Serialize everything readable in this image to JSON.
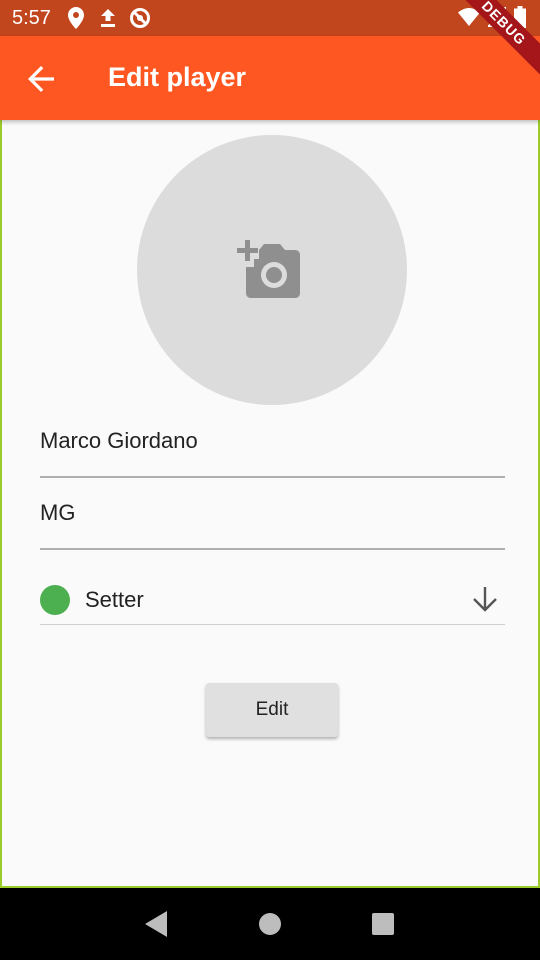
{
  "status_bar": {
    "time": "5:57",
    "icons": [
      "location-icon",
      "upload-icon",
      "no-sync-icon",
      "wifi-icon",
      "signal-icon",
      "battery-icon"
    ]
  },
  "app_bar": {
    "title": "Edit player",
    "back_icon": "arrow-back-icon",
    "color": "#ff5722"
  },
  "debug_banner": "DEBUG",
  "form": {
    "photo_icon": "add-a-photo-icon",
    "name_value": "Marco Giordano",
    "initials_value": "MG",
    "role": {
      "label": "Setter",
      "color": "#4caf50",
      "arrow_icon": "arrow-downward-icon"
    },
    "submit_label": "Edit"
  },
  "nav_bar": {
    "buttons": [
      "back-triangle-icon",
      "home-circle-icon",
      "recents-square-icon"
    ]
  }
}
